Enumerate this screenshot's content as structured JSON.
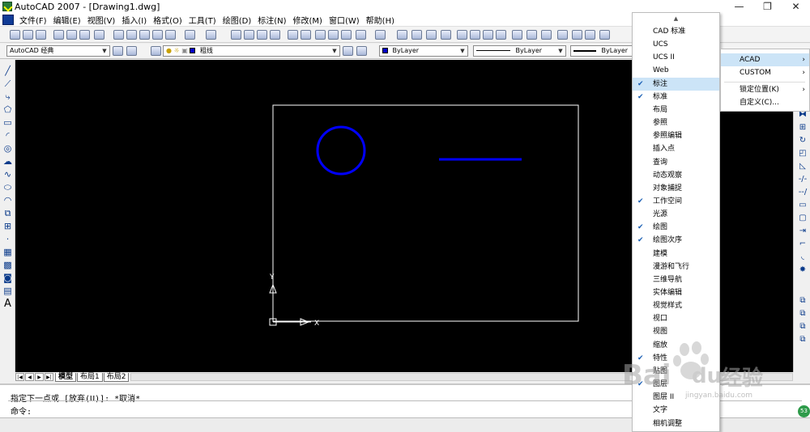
{
  "window": {
    "title": "AutoCAD 2007 - [Drawing1.dwg]",
    "min": "—",
    "restore": "❐",
    "close": "✕"
  },
  "menu": [
    "文件(F)",
    "编辑(E)",
    "视图(V)",
    "插入(I)",
    "格式(O)",
    "工具(T)",
    "绘图(D)",
    "标注(N)",
    "修改(M)",
    "窗口(W)",
    "帮助(H)"
  ],
  "toolbar2": {
    "workspace": "AutoCAD 经典",
    "layer": "粗线",
    "color": "ByLayer",
    "linetype": "ByLayer",
    "lineweight": "ByLayer",
    "layer_color": "#0000c8"
  },
  "canvas": {
    "ucs_x": "X",
    "ucs_y": "Y",
    "drawing_color": "#0000ff",
    "border_color": "#ffffff"
  },
  "tabs": {
    "model": "模型",
    "layout1": "布局1",
    "layout2": "布局2"
  },
  "command": {
    "line1": "指定下一点或 [放弃(U)]: *取消*",
    "line2": "命令:"
  },
  "context_menu": {
    "items": [
      {
        "label": "CAD 标准",
        "checked": false
      },
      {
        "label": "UCS",
        "checked": false
      },
      {
        "label": "UCS II",
        "checked": false
      },
      {
        "label": "Web",
        "checked": false
      },
      {
        "label": "标注",
        "checked": true,
        "highlight": true
      },
      {
        "label": "标准",
        "checked": true
      },
      {
        "label": "布局",
        "checked": false
      },
      {
        "label": "参照",
        "checked": false
      },
      {
        "label": "参照编辑",
        "checked": false
      },
      {
        "label": "插入点",
        "checked": false
      },
      {
        "label": "查询",
        "checked": false
      },
      {
        "label": "动态观察",
        "checked": false
      },
      {
        "label": "对象捕捉",
        "checked": false
      },
      {
        "label": "工作空间",
        "checked": true
      },
      {
        "label": "光源",
        "checked": false
      },
      {
        "label": "绘图",
        "checked": true
      },
      {
        "label": "绘图次序",
        "checked": true
      },
      {
        "label": "建模",
        "checked": false
      },
      {
        "label": "漫游和飞行",
        "checked": false
      },
      {
        "label": "三维导航",
        "checked": false
      },
      {
        "label": "实体编辑",
        "checked": false
      },
      {
        "label": "视觉样式",
        "checked": false
      },
      {
        "label": "视口",
        "checked": false
      },
      {
        "label": "视图",
        "checked": false
      },
      {
        "label": "缩放",
        "checked": false
      },
      {
        "label": "特性",
        "checked": true
      },
      {
        "label": "贴图",
        "checked": false
      },
      {
        "label": "图层",
        "checked": true
      },
      {
        "label": "图层 II",
        "checked": false
      },
      {
        "label": "文字",
        "checked": false
      },
      {
        "label": "相机调整",
        "checked": false
      }
    ]
  },
  "submenu": {
    "items": [
      {
        "label": "ACAD",
        "arrow": "›",
        "highlight": true
      },
      {
        "label": "CUSTOM",
        "arrow": "›",
        "highlight": false
      },
      {
        "label": "锁定位置(K)",
        "arrow": "›",
        "highlight": false
      },
      {
        "label": "自定义(C)...",
        "arrow": "",
        "highlight": false
      }
    ]
  },
  "watermark": {
    "brand": "Bai",
    "brand2": "du",
    "text": "经验",
    "url": "jingyan.baidu.com"
  },
  "status_badge": "53"
}
